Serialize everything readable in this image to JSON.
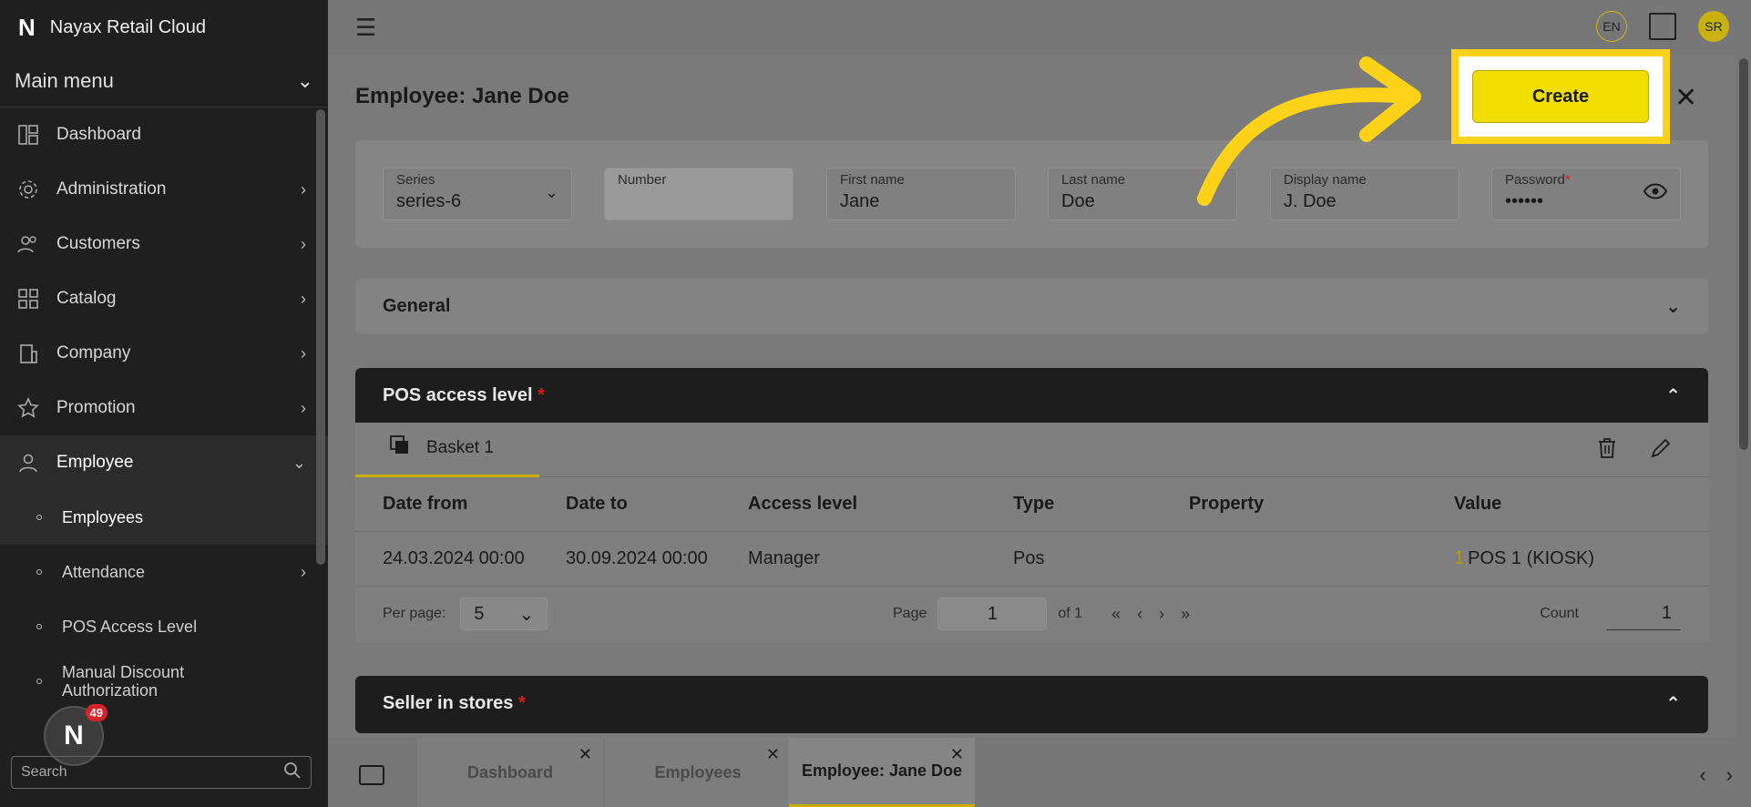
{
  "app": {
    "brand_logo": "N",
    "title": "Nayax Retail Cloud"
  },
  "sidebar": {
    "main_menu": "Main menu",
    "items": [
      {
        "label": "Dashboard",
        "icon": "dashboard-icon",
        "chevron": false
      },
      {
        "label": "Administration",
        "icon": "gear-icon",
        "chevron": true
      },
      {
        "label": "Customers",
        "icon": "users-icon",
        "chevron": true
      },
      {
        "label": "Catalog",
        "icon": "grid-icon",
        "chevron": true
      },
      {
        "label": "Company",
        "icon": "building-icon",
        "chevron": true
      },
      {
        "label": "Promotion",
        "icon": "star-icon",
        "chevron": true
      },
      {
        "label": "Employee",
        "icon": "person-icon",
        "chevron": true,
        "expanded": true
      }
    ],
    "sub_items": [
      {
        "label": "Employees",
        "active": true
      },
      {
        "label": "Attendance",
        "chevron": true
      },
      {
        "label": "POS Access Level"
      },
      {
        "label": "Manual Discount Authorization"
      }
    ],
    "search_placeholder": "Search",
    "notification_count": "49"
  },
  "topbar": {
    "lang": "EN",
    "user_initials": "SR"
  },
  "page": {
    "title": "Employee: Jane Doe",
    "create_label": "Create",
    "fields": {
      "series": {
        "label": "Series",
        "value": "series-6"
      },
      "number": {
        "label": "Number",
        "value": ""
      },
      "first_name": {
        "label": "First name",
        "value": "Jane"
      },
      "last_name": {
        "label": "Last name",
        "value": "Doe"
      },
      "display_name": {
        "label": "Display name",
        "value": "J. Doe"
      },
      "password": {
        "label": "Password",
        "required": "*",
        "value": "••••••"
      }
    },
    "general_title": "General",
    "pos_section": {
      "title": "POS access level",
      "required": "*",
      "tab_label": "Basket 1",
      "columns": [
        "Date from",
        "Date to",
        "Access level",
        "Type",
        "Property",
        "Value"
      ],
      "rows": [
        {
          "date_from": "24.03.2024 00:00",
          "date_to": "30.09.2024 00:00",
          "access_level": "Manager",
          "type": "Pos",
          "property": "",
          "value_num": "1",
          "value_text": "POS 1 (KIOSK)"
        }
      ],
      "pager": {
        "per_page_label": "Per page:",
        "per_page": "5",
        "page_label": "Page",
        "page": "1",
        "of_label": "of 1",
        "count_label": "Count",
        "count": "1"
      }
    },
    "sellers_title": "Seller in stores",
    "sellers_required": "*"
  },
  "bottom_tabs": [
    {
      "label": "Dashboard",
      "active": false
    },
    {
      "label": "Employees",
      "active": false
    },
    {
      "label": "Employee: Jane Doe",
      "active": true
    }
  ],
  "colors": {
    "accent": "#f2dd00",
    "highlight": "#ffd21a",
    "dark": "#1d1d1d"
  }
}
